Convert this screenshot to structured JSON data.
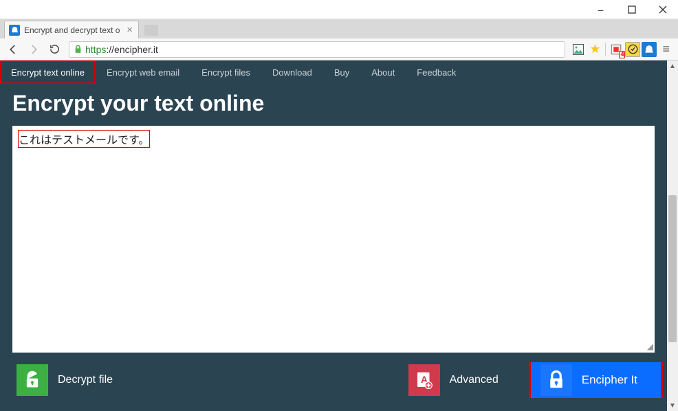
{
  "window": {
    "minimize": "–",
    "maximize": "□",
    "close": "×"
  },
  "tab": {
    "title": "Encrypt and decrypt text o",
    "favicon": "◒"
  },
  "toolbar": {
    "url_scheme": "https",
    "url_sep": "://",
    "url_host": "encipher.it",
    "badge_count": "4"
  },
  "nav": {
    "items": [
      "Encrypt text online",
      "Encrypt web email",
      "Encrypt files",
      "Download",
      "Buy",
      "About",
      "Feedback"
    ]
  },
  "page": {
    "heading": "Encrypt your text online",
    "textarea_value": "これはテストメールです。"
  },
  "actions": {
    "decrypt": "Decrypt file",
    "advanced": "Advanced",
    "encipher": "Encipher It"
  }
}
